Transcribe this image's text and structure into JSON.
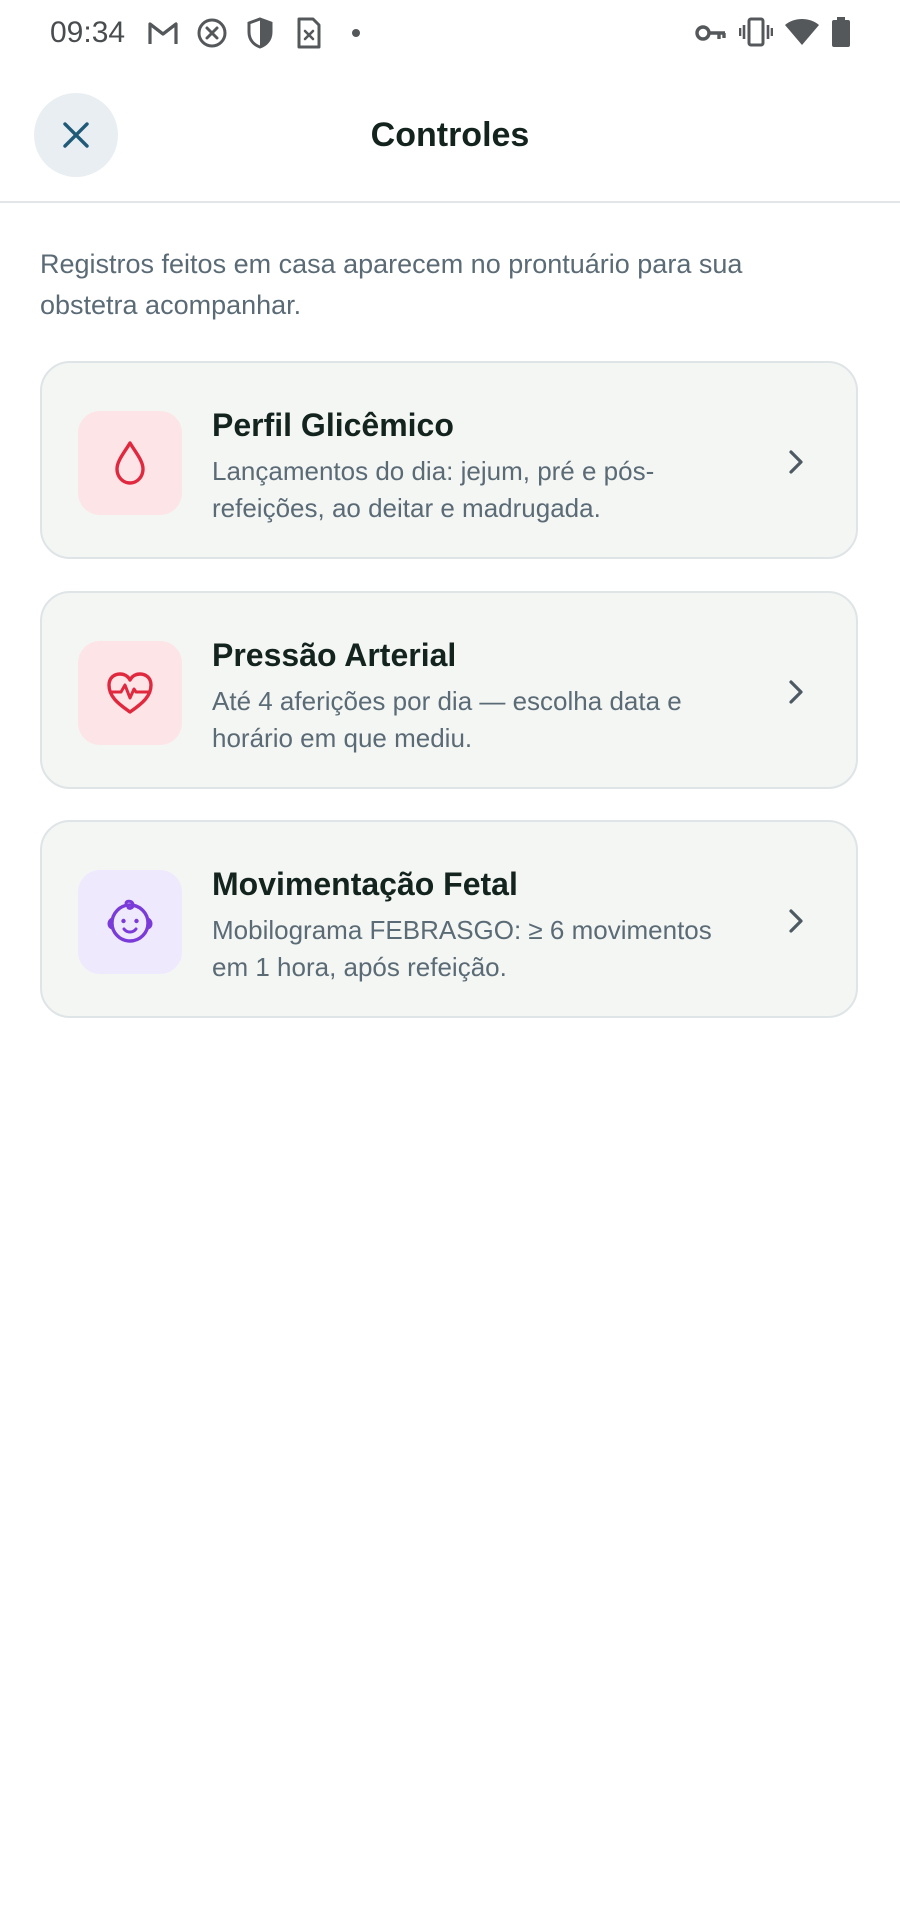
{
  "status_bar": {
    "time": "09:34",
    "icons": [
      "gmail-icon",
      "blocked-icon",
      "shield-icon",
      "sim-icon",
      "dot-icon",
      "vpn-key-icon",
      "vibrate-icon",
      "wifi-icon",
      "battery-icon"
    ]
  },
  "header": {
    "title": "Controles",
    "close_icon": "close-icon"
  },
  "intro": "Registros feitos em casa aparecem no prontuário para sua obstetra acompanhar.",
  "cards": [
    {
      "title": "Perfil Glicêmico",
      "description": "Lançamentos do dia: jejum, pré e pós-refeições, ao deitar e madrugada.",
      "icon": "drop-icon",
      "icon_bg": "#fde4e6",
      "icon_color": "#e0283e"
    },
    {
      "title": "Pressão Arterial",
      "description": "Até 4 aferições por dia — escolha data e horário em que mediu.",
      "icon": "heart-pulse-icon",
      "icon_bg": "#fde4e6",
      "icon_color": "#e0283e"
    },
    {
      "title": "Movimentação Fetal",
      "description": "Mobilograma FEBRASGO: ≥ 6 movimentos em 1 hora, após refeição.",
      "icon": "baby-face-icon",
      "icon_bg": "#efe9fd",
      "icon_color": "#7a3bd8"
    }
  ],
  "colors": {
    "text_primary": "#13231d",
    "text_secondary": "#5b6b76",
    "card_bg": "#f4f6f4",
    "card_border": "#dfe4e7",
    "close_button_bg": "#e8eef2",
    "close_icon": "#1f5a78"
  }
}
